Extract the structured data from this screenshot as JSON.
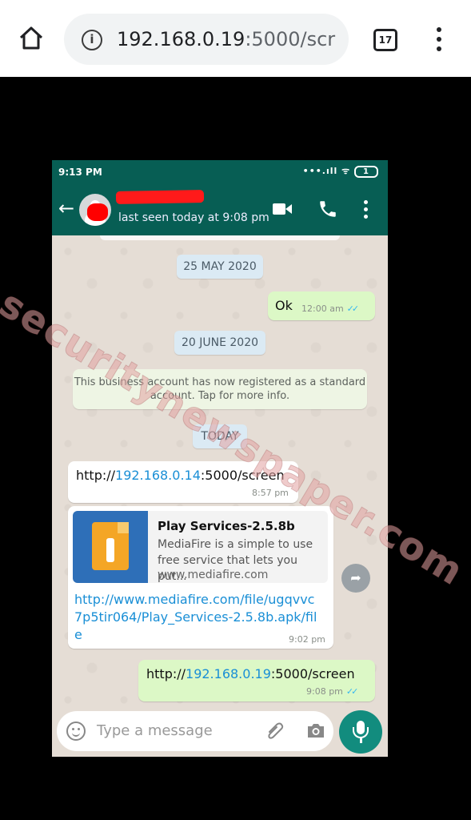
{
  "browser": {
    "url_host": "192.168.0.19",
    "url_tail": ":5000/scr",
    "tab_count": "17",
    "info_glyph": "i"
  },
  "phone": {
    "status": {
      "time": "9:13 PM",
      "battery": "1"
    },
    "chat_header": {
      "last_seen": "last seen today at 9:08 pm"
    },
    "messages": {
      "date_1": "25 MAY 2020",
      "ok_text": "Ok",
      "ok_time": "12:00 am",
      "date_2": "20 JUNE 2020",
      "system_notice": "This business account has now registered as a standard account. Tap for more info.",
      "date_3": "TODAY",
      "in_link": {
        "prefix": "http://",
        "ip": "192.168.0.14",
        "suffix": ":5000/screen",
        "time": "8:57 pm"
      },
      "preview": {
        "title": "Play Services-2.5.8b",
        "description": "MediaFire is a simple to use free service that lets you put...",
        "domain": "www.mediafire.com",
        "link": "http://www.mediafire.com/file/ugqvvc7p5tir064/Play_Services-2.5.8b.apk/file",
        "time": "9:02 pm"
      },
      "out_link": {
        "prefix": "http://",
        "ip": "192.168.0.19",
        "suffix": ":5000/screen",
        "time": "9:08 pm"
      }
    },
    "composer": {
      "placeholder": "Type a message"
    }
  },
  "watermark": "securitynewspaper.com",
  "colors": {
    "header": "#075e54",
    "outgoing": "#dcf8c6",
    "link": "#1a8fd6",
    "mic": "#128c7e"
  }
}
